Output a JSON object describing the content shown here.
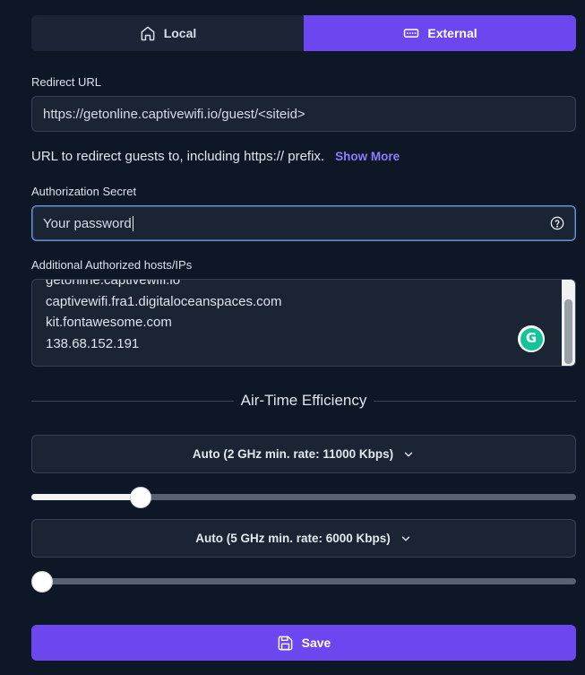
{
  "mode_toggle": {
    "local_label": "Local",
    "external_label": "External",
    "active": "External"
  },
  "redirect": {
    "label": "Redirect URL",
    "value": "https://getonline.captivewifi.io/guest/<siteid>",
    "helper": "URL to redirect guests to, including https:// prefix.",
    "show_more": "Show More"
  },
  "auth_secret": {
    "label": "Authorization Secret",
    "value": "Your password"
  },
  "hosts": {
    "label": "Additional Authorized hosts/IPs",
    "lines": [
      "getonline.captivewifi.io",
      "captivewifi.fra1.digitaloceanspaces.com",
      "kit.fontawesome.com",
      "138.68.152.191"
    ]
  },
  "airtime": {
    "title": "Air-Time Efficiency",
    "band_2ghz": {
      "label": "Auto (2 GHz min. rate: 11000 Kbps)",
      "slider_fraction": 0.2
    },
    "band_5ghz": {
      "label": "Auto (5 GHz min. rate: 6000 Kbps)",
      "slider_fraction": 0.0
    }
  },
  "save_label": "Save",
  "colors": {
    "accent": "#6c47f0",
    "background": "#0e1726",
    "link": "#8c7bff",
    "grammarly": "#15c39a"
  }
}
